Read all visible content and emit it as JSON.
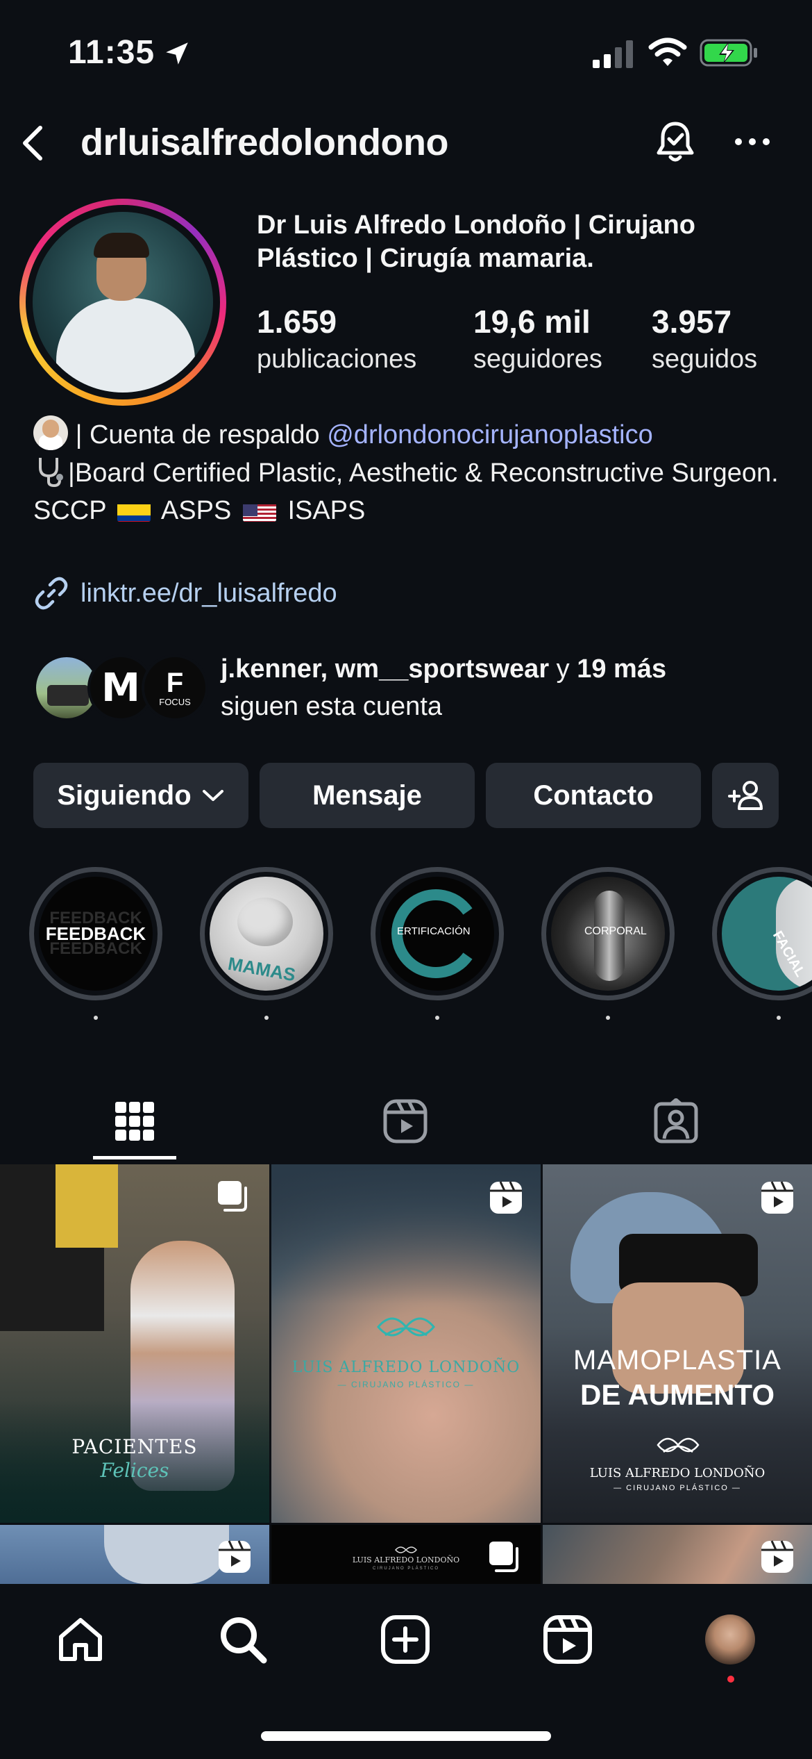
{
  "status_bar": {
    "time": "11:35"
  },
  "header": {
    "username": "drluisalfredolondono"
  },
  "profile": {
    "display_name": "Dr Luis Alfredo Londoño | Cirujano Plástico | Cirugía mamaria.",
    "stats": [
      {
        "value": "1.659",
        "label": "publicaciones"
      },
      {
        "value": "19,6 mil",
        "label": "seguidores"
      },
      {
        "value": "3.957",
        "label": "seguidos"
      }
    ],
    "bio": {
      "line1_prefix": "| Cuenta de respaldo ",
      "line1_mention": "@drlondonocirujanoplastico",
      "line2": "|Board Certified Plastic, Aesthetic & Reconstructive Surgeon.",
      "line3_a": "SCCP",
      "line3_b": "ASPS",
      "line3_c": "ISAPS"
    },
    "link": "linktr.ee/dr_luisalfredo"
  },
  "followed_by": {
    "names": "j.kenner, wm__sportswear",
    "connector": " y ",
    "more": "19 más",
    "suffix": "siguen esta cuenta",
    "avatar_labels": [
      "M",
      "FOCUS"
    ]
  },
  "actions": {
    "following": "Siguiendo",
    "message": "Mensaje",
    "contact": "Contacto"
  },
  "highlights": [
    {
      "title": "FEEDBACK",
      "echo": "FEEDBACK"
    },
    {
      "title": "MAMAS"
    },
    {
      "title": "ERTIFICACIÓN"
    },
    {
      "title": "CORPORAL"
    },
    {
      "title": "FACIAL"
    }
  ],
  "posts": [
    {
      "caption_main": "PACIENTES",
      "caption_script": "Felices",
      "type": "carousel"
    },
    {
      "caption_main": "LUIS ALFREDO LONDOÑO",
      "caption_sub": "— CIRUJANO PLÁSTICO —",
      "type": "reel"
    },
    {
      "caption_main": "MAMOPLASTIA",
      "caption_bold": "DE AUMENTO",
      "caption_sub": "LUIS ALFREDO LONDOÑO",
      "caption_sub2": "— CIRUJANO PLÁSTICO —",
      "type": "reel"
    },
    {
      "type": "reel"
    },
    {
      "caption_main": "LUIS ALFREDO LONDOÑO",
      "caption_sub": "CIRUJANO PLÁSTICO",
      "type": "carousel"
    },
    {
      "type": "reel"
    }
  ],
  "colors": {
    "background": "#0c0f14",
    "button": "#262b33",
    "mention": "#a5b4ff",
    "link": "#b6d0f0",
    "notification_dot": "#ff3040"
  }
}
